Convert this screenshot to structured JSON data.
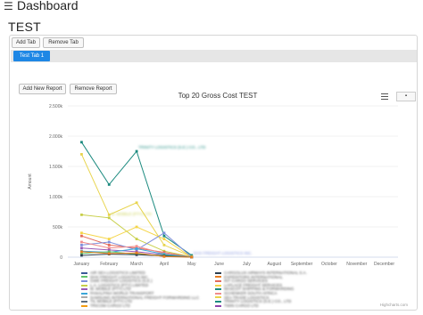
{
  "header": {
    "menu_icon": "hamburger-icon",
    "title": "Dashboard"
  },
  "page": {
    "title": "TEST"
  },
  "tabs_toolbar": {
    "add_tab": "Add Tab",
    "remove_tab": "Remove Tab"
  },
  "tabs": [
    {
      "label": "Test Tab 1",
      "active": true
    }
  ],
  "report_toolbar": {
    "add_report": "Add New Report",
    "remove_report": "Remove Report",
    "menu_icon": "hamburger-icon"
  },
  "chart_data": {
    "type": "line",
    "title": "Top 20 Gross Cost TEST",
    "ylabel": "Amount",
    "ylim": [
      0,
      2500000
    ],
    "y_ticks": [
      "0",
      "500k",
      "1.000k",
      "1.500k",
      "2.000k",
      "2.500k"
    ],
    "categories": [
      "January",
      "February",
      "March",
      "April",
      "May",
      "June",
      "July",
      "August",
      "September",
      "October",
      "November",
      "December"
    ],
    "series": [
      {
        "color": "#1b8a7f",
        "values": [
          1900000,
          1200000,
          1750000,
          350000,
          30000
        ]
      },
      {
        "color": "#e8d44d",
        "values": [
          1700000,
          700000,
          900000,
          200000,
          10000
        ]
      },
      {
        "color": "#c8cf4a",
        "values": [
          700000,
          650000,
          300000,
          100000,
          5000
        ]
      },
      {
        "color": "#f5d547",
        "values": [
          400000,
          300000,
          500000,
          300000,
          0
        ]
      },
      {
        "color": "#e36a5a",
        "values": [
          350000,
          200000,
          150000,
          80000,
          0
        ]
      },
      {
        "color": "#7f8fdc",
        "values": [
          200000,
          250000,
          120000,
          400000,
          0
        ]
      },
      {
        "color": "#f08c8c",
        "values": [
          250000,
          150000,
          180000,
          60000,
          0
        ]
      },
      {
        "color": "#9b59b6",
        "values": [
          150000,
          120000,
          90000,
          40000,
          0
        ]
      },
      {
        "color": "#3aa6d8",
        "values": [
          100000,
          80000,
          140000,
          50000,
          0
        ]
      },
      {
        "color": "#60c46a",
        "values": [
          60000,
          90000,
          50000,
          30000,
          0
        ]
      },
      {
        "color": "#2c3e50",
        "values": [
          30000,
          50000,
          40000,
          20000,
          0
        ]
      },
      {
        "color": "#e67e22",
        "values": [
          90000,
          60000,
          70000,
          10000,
          0
        ]
      }
    ],
    "data_labels": [
      {
        "series": 0,
        "text": "TRINITY LOGISTICS (S.E.) CO., LTD"
      },
      {
        "series": 2,
        "text": "M. MOBILE (PTY) LTD"
      },
      {
        "series": 5,
        "text": "DHX FREIGHT LOGISTICS INC."
      }
    ],
    "legend": [
      {
        "color": "#3b5998",
        "text": "AIR SEA LOGISTICS LIMITED"
      },
      {
        "color": "#2c3e50",
        "text": "CARGOLUX AIRWAYS INTERNATIONAL S.A."
      },
      {
        "color": "#60c46a",
        "text": "DHX FREIGHT LOGISTICS INC."
      },
      {
        "color": "#e67e22",
        "text": "EXPEDITORS INTERNATIONAL"
      },
      {
        "color": "#7f8fdc",
        "text": "GWE FREIGHT LOGISTICS (S.E.)"
      },
      {
        "color": "#e36a5a",
        "text": "INT CARGO SERVICES"
      },
      {
        "color": "#c8cf4a",
        "text": "L.A. LOGISTICS (PTY) LIMITED"
      },
      {
        "color": "#f5d547",
        "text": "LAPLACE FREIGHT SERVICES"
      },
      {
        "color": "#9b59b6",
        "text": "M. MOBILE (PTY) LTD"
      },
      {
        "color": "#1b8a7f",
        "text": "MASCOT SHIPPING & FORWARDING"
      },
      {
        "color": "#3aa6d8",
        "text": "PANALPINA WORLD TRANSPORT"
      },
      {
        "color": "#f08c8c",
        "text": "SCHENKER SOUTH AFRICA"
      },
      {
        "color": "#aaaaaa",
        "text": "SAMSUNG INTERNATIONAL FREIGHT FORWARDING LLC"
      },
      {
        "color": "#e8d44d",
        "text": "SEA TRADE LOGISTICS"
      },
      {
        "color": "#5d6d7e",
        "text": "TIL MOBILE (PTY) LTD"
      },
      {
        "color": "#1b8a7f",
        "text": "TRINITY LOGISTICS (S.E.) CO., LTD"
      },
      {
        "color": "#f39c12",
        "text": "TRICOM CARGO LTD"
      },
      {
        "color": "#8e44ad",
        "text": "TWIN CARGO LTD"
      }
    ],
    "credits": "Highcharts.com"
  }
}
